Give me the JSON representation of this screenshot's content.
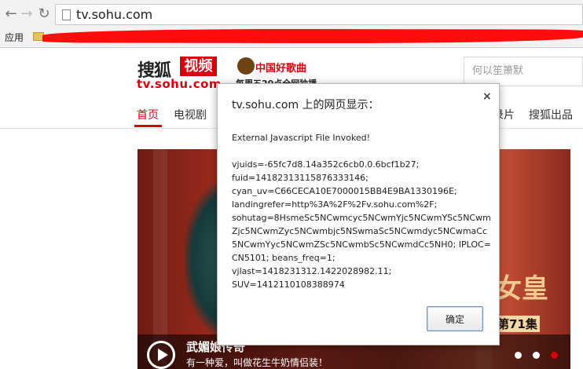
{
  "browser": {
    "url": "tv.sohu.com",
    "bookmarks_apps_label": "应用"
  },
  "header": {
    "logo_main": "搜狐",
    "logo_badge": "视频",
    "logo_sub": "tv.sohu.com",
    "promo_title": "中国好歌曲",
    "promo_sub": "每周五20点全网独播",
    "search_placeholder": "何以笙箫默"
  },
  "nav": {
    "items": [
      {
        "label": "首页",
        "active": true
      },
      {
        "label": "电视剧",
        "active": false
      },
      {
        "label": "录片",
        "active": false
      },
      {
        "label": "搜狐出品",
        "active": false
      }
    ]
  },
  "banner": {
    "caption_title": "武媚娘传奇",
    "caption_sub": "有一种爱，叫做花生牛奶情侣装！",
    "big_title": "女皇",
    "episode": "第71集"
  },
  "dialog": {
    "title": "tv.sohu.com 上的网页显示：",
    "close_symbol": "×",
    "message": "External Javascript File Invoked!\n\nvjuids=-65fc7d8.14a352c6cb0.0.6bcf1b27;\nfuid=14182313115876333146;\ncyan_uv=C66CECA10E7000015BB4E9BA1330196E;\nlandingrefer=http%3A%2F%2Fv.sohu.com%2F;\nsohutag=8HsmeSc5NCwmcyc5NCwmYjc5NCwmYSc5NCwmZjc5NCwmZyc5NCwmbjc5NSwmaSc5NCwmdyc5NCwmaCc5NCwmYyc5NCwmZSc5NCwmbSc5NCwmdCc5NH0; IPLOC=CN5101; beans_freq=1;\nvjlast=1418231312.1422028982.11;\nSUV=1412110108388974",
    "ok_label": "确定"
  }
}
